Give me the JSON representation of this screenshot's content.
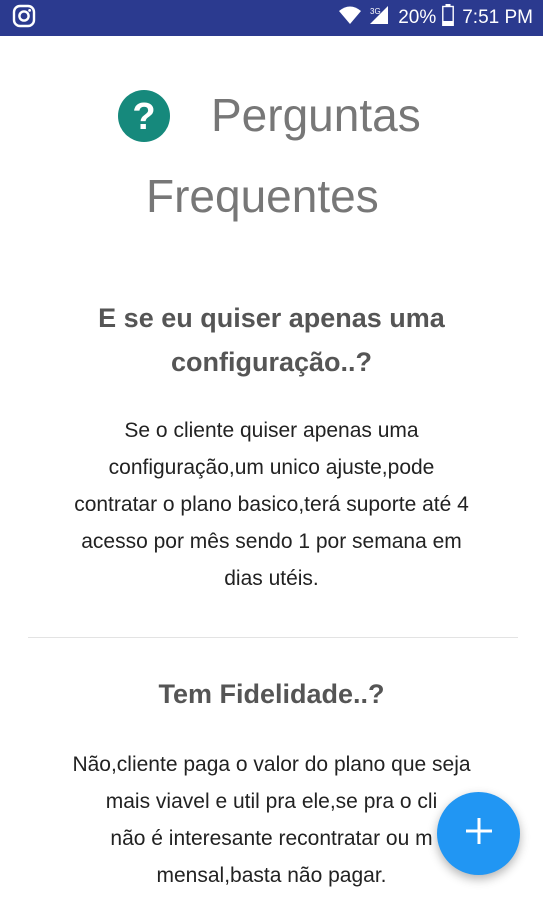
{
  "status_bar": {
    "app_icon": "instagram-icon",
    "wifi_icon": "wifi-icon",
    "signal_icon": "cell-signal-icon",
    "battery_icon": "battery-icon",
    "battery_percent": "20%",
    "time": "7:51 PM",
    "background_color": "#2b3a8f"
  },
  "header": {
    "icon": "help-circle-icon",
    "icon_color": "#16897c",
    "title_line1": "Perguntas",
    "title_line2": "Frequentes"
  },
  "faq": [
    {
      "question_lines": [
        "E se eu quiser apenas uma",
        "configuração..?"
      ],
      "answer_lines": [
        "Se o cliente quiser apenas uma",
        "configuração,um unico ajuste,pode",
        "contratar o plano basico,terá suporte até 4",
        "acesso por mês sendo 1 por semana em",
        "dias utéis."
      ]
    },
    {
      "question_lines": [
        "Tem Fidelidade..?"
      ],
      "answer_lines": [
        "Não,cliente paga o valor do plano que seja",
        "mais viavel e util pra ele,se pra o cli",
        "não é interesante recontratar ou m",
        "mensal,basta não pagar."
      ]
    }
  ],
  "fab": {
    "icon": "plus-icon",
    "color": "#2196f3"
  }
}
